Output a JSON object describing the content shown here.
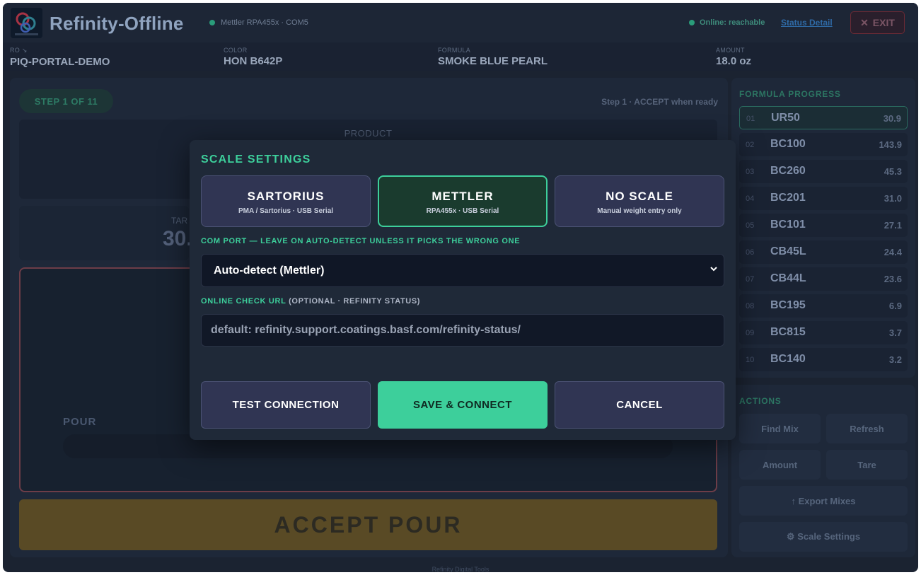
{
  "app": {
    "title": "Refinity-Offline",
    "device": "Mettler RPA455x · COM5",
    "online_status": "Online: reachable",
    "status_detail_link": "Status Detail",
    "exit_label": "EXIT",
    "footer": "Refinity Digital Tools"
  },
  "info": [
    {
      "label": "RO ↘",
      "value": "PIQ-PORTAL-DEMO"
    },
    {
      "label": "COLOR",
      "value": "HON B642P"
    },
    {
      "label": "FORMULA",
      "value": "SMOKE BLUE PEARL"
    },
    {
      "label": "AMOUNT",
      "value": "18.0 oz"
    }
  ],
  "main": {
    "step_badge": "STEP 1 OF 11",
    "step_hint": "Step 1 · ACCEPT when ready",
    "product_label": "PRODUCT",
    "target_label": "TAR",
    "target_value": "30.",
    "pour_label": "POUR",
    "accept_button": "ACCEPT POUR"
  },
  "progress": {
    "heading": "FORMULA PROGRESS",
    "items": [
      {
        "num": "01",
        "code": "UR50",
        "amount": "30.9",
        "active": true
      },
      {
        "num": "02",
        "code": "BC100",
        "amount": "143.9"
      },
      {
        "num": "03",
        "code": "BC260",
        "amount": "45.3"
      },
      {
        "num": "04",
        "code": "BC201",
        "amount": "31.0"
      },
      {
        "num": "05",
        "code": "BC101",
        "amount": "27.1"
      },
      {
        "num": "06",
        "code": "CB45L",
        "amount": "24.4"
      },
      {
        "num": "07",
        "code": "CB44L",
        "amount": "23.6"
      },
      {
        "num": "08",
        "code": "BC195",
        "amount": "6.9"
      },
      {
        "num": "09",
        "code": "BC815",
        "amount": "3.7"
      },
      {
        "num": "10",
        "code": "BC140",
        "amount": "3.2"
      }
    ]
  },
  "actions": {
    "heading": "ACTIONS",
    "find_mix": "Find Mix",
    "refresh": "Refresh",
    "amount": "Amount",
    "tare": "Tare",
    "export_mixes": "↑ Export Mixes",
    "scale_settings": "⚙ Scale Settings"
  },
  "modal": {
    "title": "SCALE SETTINGS",
    "scale_options": [
      {
        "name": "SARTORIUS",
        "sub": "PMA / Sartorius · USB Serial"
      },
      {
        "name": "METTLER",
        "sub": "RPA455x · USB Serial",
        "selected": true
      },
      {
        "name": "NO SCALE",
        "sub": "Manual weight entry only"
      }
    ],
    "com_port_label": "COM PORT — LEAVE ON AUTO-DETECT UNLESS IT PICKS THE WRONG ONE",
    "com_port_value": "Auto-detect (Mettler)",
    "url_label": "ONLINE CHECK URL",
    "url_label_optional": "(OPTIONAL · REFINITY STATUS)",
    "url_placeholder": "default: refinity.support.coatings.basf.com/refinity-status/",
    "test_button": "TEST CONNECTION",
    "save_button": "SAVE & CONNECT",
    "cancel_button": "CANCEL"
  },
  "colors": {
    "accent": "#3dcf9b",
    "background": "#1b2331",
    "panel": "#1e2839",
    "modal": "#1f2938",
    "selected_option": "#1a3b2e",
    "accept_button": "#594a25"
  }
}
